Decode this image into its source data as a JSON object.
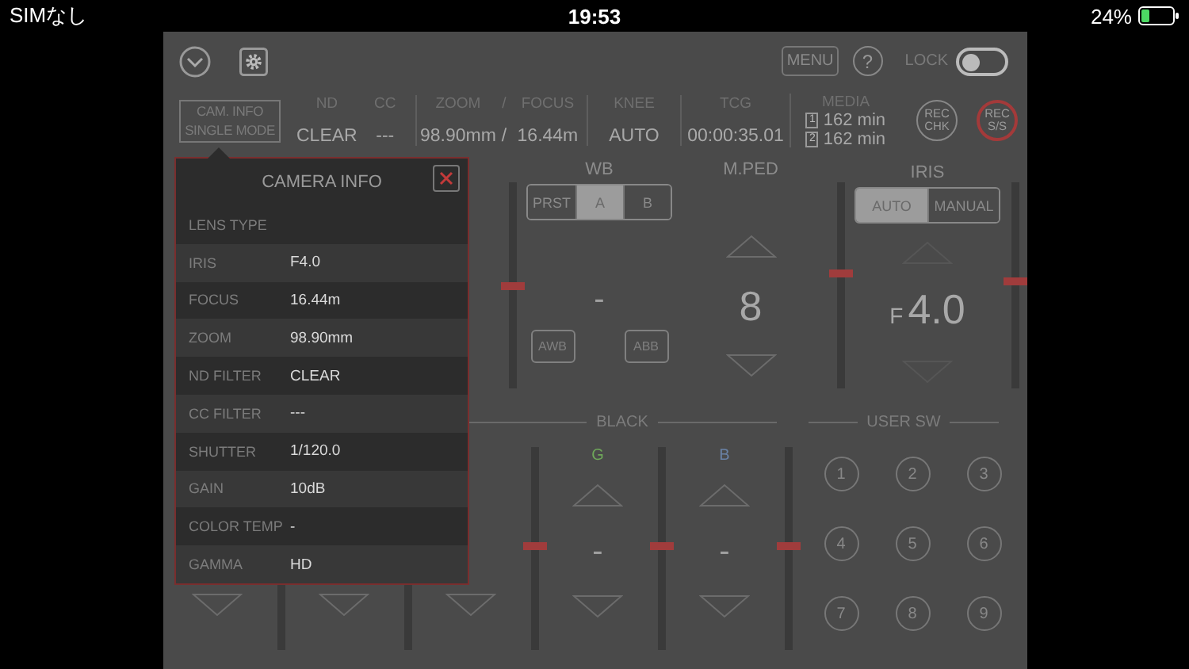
{
  "status_bar": {
    "carrier": "SIMなし",
    "time": "19:53",
    "battery": "24%"
  },
  "toolbar": {
    "menu": "MENU",
    "help": "?",
    "lock": {
      "label": "LOCK",
      "on": false
    }
  },
  "info_bar": {
    "cam_info": [
      "CAM. INFO",
      "SINGLE MODE"
    ],
    "groups": [
      {
        "items": [
          {
            "label": "ND",
            "value": "CLEAR"
          },
          {
            "label": "CC",
            "value": "---"
          }
        ]
      },
      {
        "items": [
          {
            "label": "ZOOM",
            "value": "98.90mm"
          },
          {
            "label": "/",
            "value": "/"
          },
          {
            "label": "FOCUS",
            "value": "16.44m"
          }
        ]
      },
      {
        "items": [
          {
            "label": "KNEE",
            "value": "AUTO"
          }
        ]
      },
      {
        "items": [
          {
            "label": "TCG",
            "value": "00:00:35.01"
          }
        ]
      }
    ],
    "media": {
      "label": "MEDIA",
      "slots": [
        {
          "slot": "1",
          "remaining": "162 min"
        },
        {
          "slot": "2",
          "remaining": "162 min"
        }
      ]
    },
    "rec_buttons": [
      {
        "lines": [
          "REC",
          "CHK"
        ],
        "highlighted": false
      },
      {
        "lines": [
          "REC",
          "S/S"
        ],
        "highlighted": true
      }
    ]
  },
  "wb": {
    "title": "WB",
    "modes": [
      {
        "label": "PRST",
        "selected": false
      },
      {
        "label": "A",
        "selected": true
      },
      {
        "label": "B",
        "selected": false
      }
    ],
    "value": "-",
    "buttons": [
      "AWB",
      "ABB"
    ],
    "level": 0.5
  },
  "mped": {
    "title": "M.PED",
    "value": "8"
  },
  "iris": {
    "title": "IRIS",
    "modes": [
      {
        "label": "AUTO",
        "selected": true
      },
      {
        "label": "MANUAL",
        "selected": false
      }
    ],
    "prefix": "F",
    "value": "4.0",
    "level": 0.56,
    "side_slider": {
      "level": 0.52
    }
  },
  "black": {
    "title": "BLACK",
    "columns": [
      {
        "kind": "covered"
      },
      {
        "kind": "covered"
      },
      {
        "kind": "covered",
        "level": 0.51
      },
      {
        "kind": "channel",
        "label": "G",
        "color": "#6fa85a",
        "value": "-",
        "level": 0.51
      },
      {
        "kind": "channel",
        "label": "B",
        "color": "#6a82a6",
        "value": "-",
        "level": 0.51
      }
    ]
  },
  "user_sw": {
    "title": "USER SW",
    "buttons": [
      "1",
      "2",
      "3",
      "4",
      "5",
      "6",
      "7",
      "8",
      "9"
    ]
  },
  "camera_info": {
    "title": "CAMERA INFO",
    "rows": [
      {
        "label": "LENS TYPE"
      },
      {
        "label": "IRIS",
        "value": "F4.0"
      },
      {
        "label": "FOCUS",
        "value": "16.44m"
      },
      {
        "label": "ZOOM",
        "value": "98.90mm"
      },
      {
        "label": "ND FILTER",
        "value": "CLEAR"
      },
      {
        "label": "CC FILTER",
        "value": "---"
      },
      {
        "label": "SHUTTER",
        "value": "1/120.0"
      },
      {
        "label": "GAIN",
        "value": "10dB"
      },
      {
        "label": "COLOR TEMP",
        "value": "-"
      },
      {
        "label": "GAMMA",
        "value": "HD"
      }
    ]
  }
}
